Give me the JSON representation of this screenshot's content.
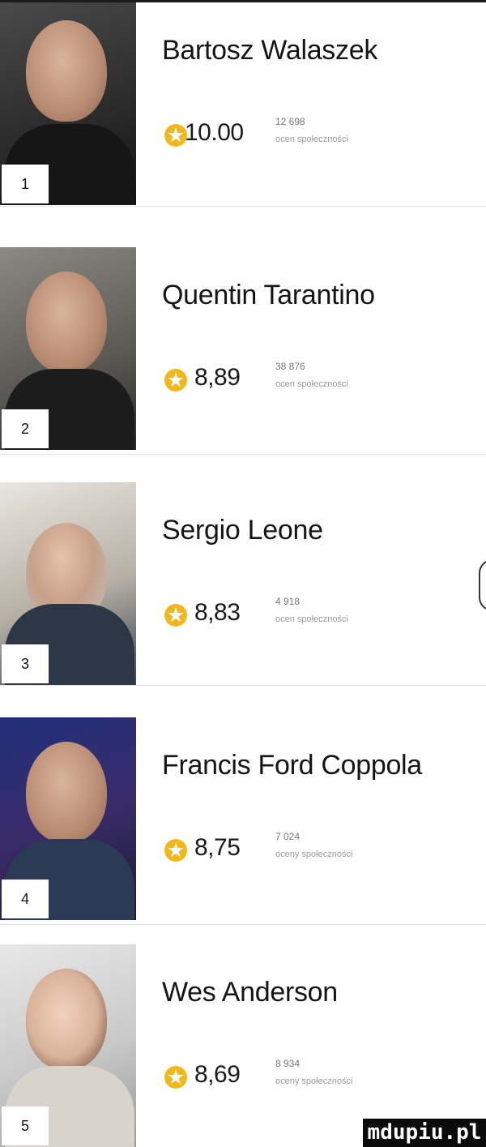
{
  "rankings": [
    {
      "rank": "1",
      "name": "Bartosz Walaszek",
      "score": "10.00",
      "count": "12 698",
      "count_label": "ocen społeczności"
    },
    {
      "rank": "2",
      "name": "Quentin Tarantino",
      "score": "8,89",
      "count": "38 876",
      "count_label": "ocen społeczności"
    },
    {
      "rank": "3",
      "name": "Sergio Leone",
      "score": "8,83",
      "count": "4 918",
      "count_label": "ocen społeczności"
    },
    {
      "rank": "4",
      "name": "Francis Ford Coppola",
      "score": "8,75",
      "count": "7 024",
      "count_label": "oceny społeczności"
    },
    {
      "rank": "5",
      "name": "Wes Anderson",
      "score": "8,69",
      "count": "8 934",
      "count_label": "oceny społeczności"
    }
  ],
  "colors": {
    "star": "#f2b81b",
    "text": "#1a1a1a"
  },
  "icons": {
    "rating": "star-icon"
  },
  "watermark": "mdupiu.pl"
}
